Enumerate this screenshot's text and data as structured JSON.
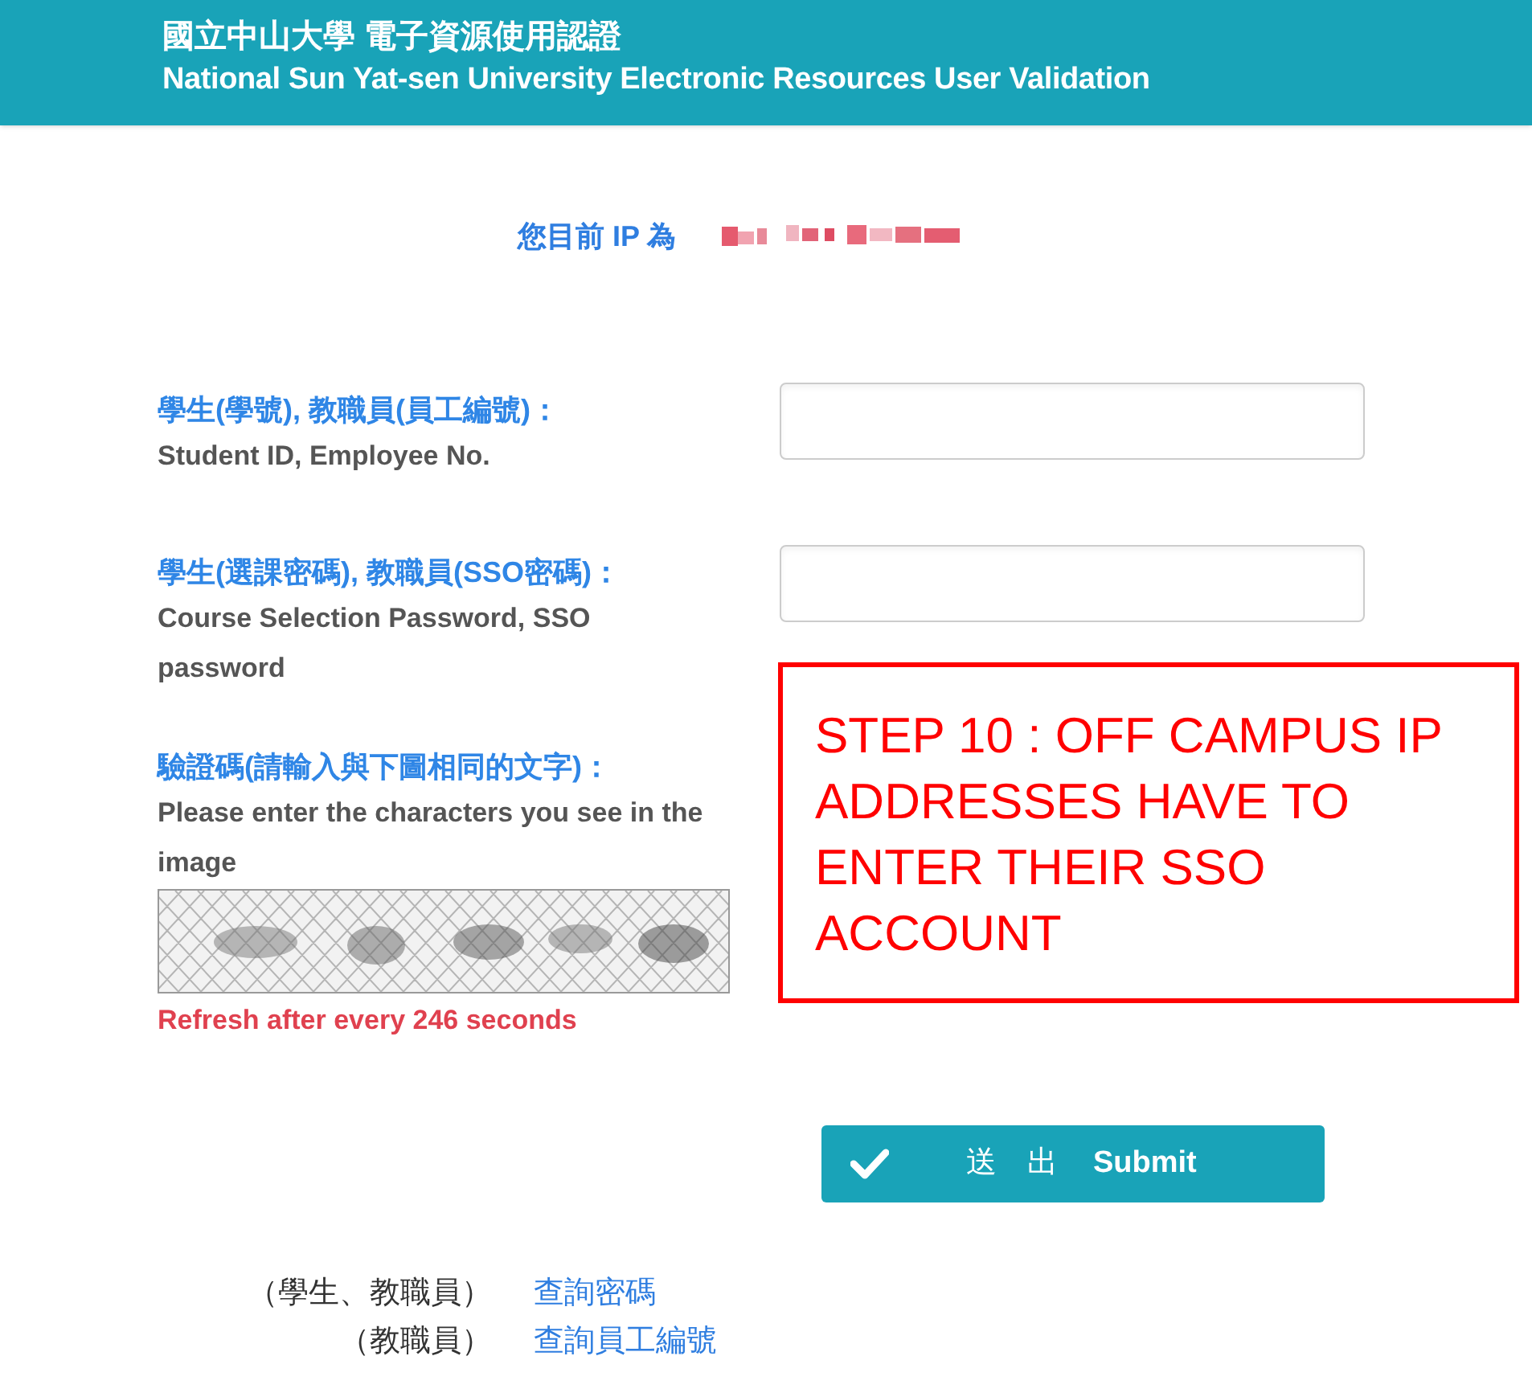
{
  "header": {
    "title": "國立中山大學 電子資源使用認證",
    "subtitle": "National Sun Yat-sen University Electronic Resources User Validation"
  },
  "ip_label": "您目前 IP 為",
  "fields": [
    {
      "label_zh": "學生(學號), 教職員(員工編號)：",
      "label_en": "Student ID, Employee No."
    },
    {
      "label_zh": "學生(選課密碼), 教職員(SSO密碼)：",
      "label_en": "Course Selection Password, SSO password"
    }
  ],
  "captcha": {
    "label_zh": "驗證碼(請輸入與下圖相同的文字)：",
    "label_en": "Please enter the characters you see in the image",
    "refresh_note": "Refresh after every 246 seconds"
  },
  "annotation": {
    "text": "STEP 10 : OFF CAMPUS IP ADDRESSES HAVE TO ENTER THEIR SSO ACCOUNT"
  },
  "submit": {
    "label_zh": "送　出",
    "label": "Submit"
  },
  "links": [
    {
      "prefix": "（學生、教職員）",
      "link": "查詢密碼"
    },
    {
      "prefix": "（教職員）",
      "link": "查詢員工編號"
    }
  ]
}
